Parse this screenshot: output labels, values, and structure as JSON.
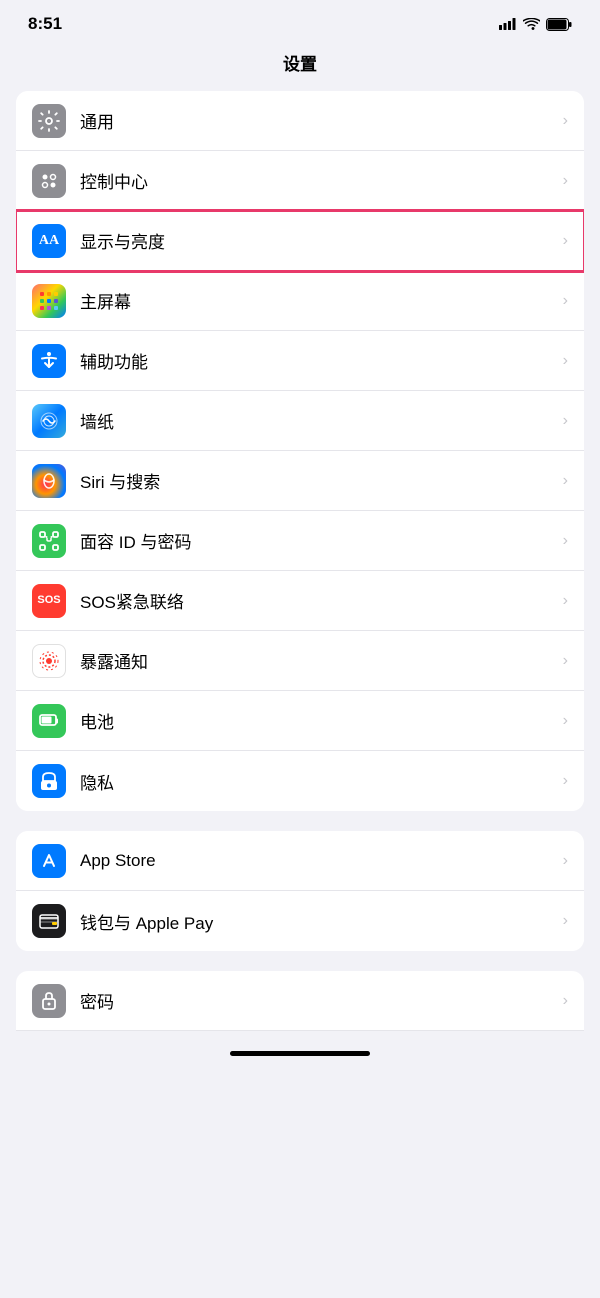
{
  "statusBar": {
    "time": "8:51",
    "signal": "signal",
    "wifi": "wifi",
    "battery": "battery"
  },
  "pageTitle": "设置",
  "section1": {
    "items": [
      {
        "id": "general",
        "label": "通用",
        "iconBg": "gray",
        "highlighted": false
      },
      {
        "id": "control-center",
        "label": "控制中心",
        "iconBg": "gray",
        "highlighted": false
      },
      {
        "id": "display",
        "label": "显示与亮度",
        "iconBg": "blue",
        "highlighted": true
      },
      {
        "id": "home-screen",
        "label": "主屏幕",
        "iconBg": "multicolor",
        "highlighted": false
      },
      {
        "id": "accessibility",
        "label": "辅助功能",
        "iconBg": "light-blue",
        "highlighted": false
      },
      {
        "id": "wallpaper",
        "label": "墙纸",
        "iconBg": "teal-floral",
        "highlighted": false
      },
      {
        "id": "siri",
        "label": "Siri 与搜索",
        "iconBg": "siri",
        "highlighted": false
      },
      {
        "id": "face-id",
        "label": "面容 ID 与密码",
        "iconBg": "green",
        "highlighted": false
      },
      {
        "id": "sos",
        "label": "SOS紧急联络",
        "iconBg": "red",
        "highlighted": false
      },
      {
        "id": "exposure",
        "label": "暴露通知",
        "iconBg": "red-dot",
        "highlighted": false
      },
      {
        "id": "battery",
        "label": "电池",
        "iconBg": "green",
        "highlighted": false
      },
      {
        "id": "privacy",
        "label": "隐私",
        "iconBg": "blue",
        "highlighted": false
      }
    ]
  },
  "section2": {
    "items": [
      {
        "id": "app-store",
        "label": "App Store",
        "iconBg": "blue"
      },
      {
        "id": "wallet",
        "label": "钱包与 Apple Pay",
        "iconBg": "black"
      }
    ]
  },
  "section3": {
    "items": [
      {
        "id": "passwords",
        "label": "密码",
        "iconBg": "gray"
      }
    ]
  },
  "chevron": "›"
}
